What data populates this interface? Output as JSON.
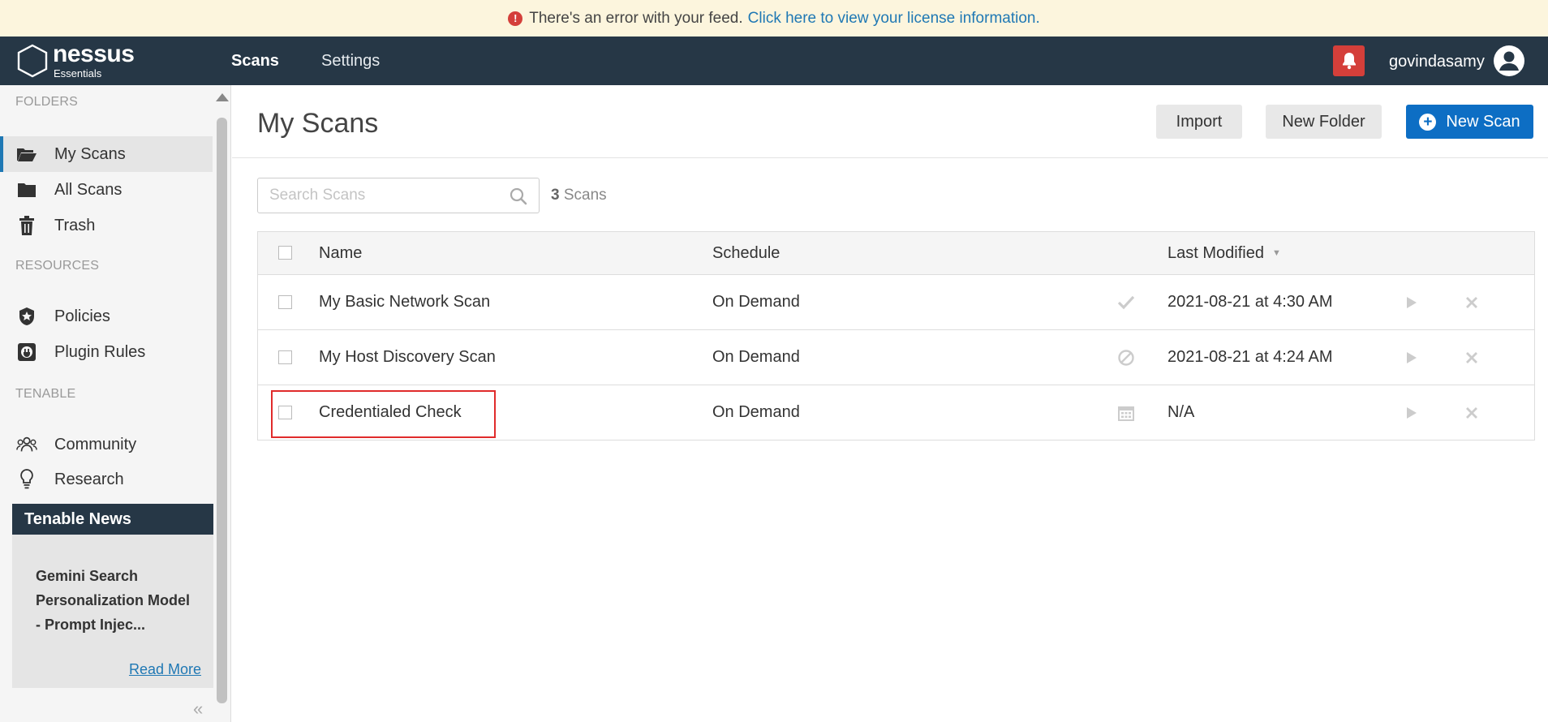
{
  "banner": {
    "message": "There's an error with your feed.",
    "link": "Click here to view your license information."
  },
  "header": {
    "logo_name": "nessus",
    "logo_sub": "Essentials",
    "nav": [
      {
        "label": "Scans",
        "active": true
      },
      {
        "label": "Settings",
        "active": false
      }
    ],
    "username": "govindasamy"
  },
  "sidebar": {
    "folders_heading": "FOLDERS",
    "folders": [
      {
        "label": "My Scans",
        "icon": "folder-open-icon",
        "active": true
      },
      {
        "label": "All Scans",
        "icon": "folder-icon",
        "active": false
      },
      {
        "label": "Trash",
        "icon": "trash-icon",
        "active": false
      }
    ],
    "resources_heading": "RESOURCES",
    "resources": [
      {
        "label": "Policies",
        "icon": "shield-star-icon"
      },
      {
        "label": "Plugin Rules",
        "icon": "plug-icon"
      }
    ],
    "tenable_heading": "TENABLE",
    "tenable": [
      {
        "label": "Community",
        "icon": "community-icon"
      },
      {
        "label": "Research",
        "icon": "lightbulb-icon"
      }
    ],
    "news": {
      "title": "Tenable News",
      "headline": "Gemini Search Personalization Model - Prompt Injec...",
      "read_more": "Read More"
    }
  },
  "main": {
    "title": "My Scans",
    "buttons": {
      "import": "Import",
      "new_folder": "New Folder",
      "new_scan": "New Scan"
    },
    "search_placeholder": "Search Scans",
    "scan_count": "3",
    "scan_count_label": "Scans",
    "columns": {
      "name": "Name",
      "schedule": "Schedule",
      "last_modified": "Last Modified"
    },
    "rows": [
      {
        "name": "My Basic Network Scan",
        "schedule": "On Demand",
        "status_icon": "check-icon",
        "last_modified": "2021-08-21 at 4:30 AM"
      },
      {
        "name": "My Host Discovery Scan",
        "schedule": "On Demand",
        "status_icon": "canceled-icon",
        "last_modified": "2021-08-21 at 4:24 AM"
      },
      {
        "name": "Credentialed Check",
        "schedule": "On Demand",
        "status_icon": "calendar-icon",
        "last_modified": "N/A"
      }
    ]
  },
  "colors": {
    "header_bg": "#263746",
    "accent_blue": "#0d6ec4",
    "alert_red": "#d43f3a",
    "banner_bg": "#fcf5dd",
    "highlight_box": "#e02b2b"
  }
}
